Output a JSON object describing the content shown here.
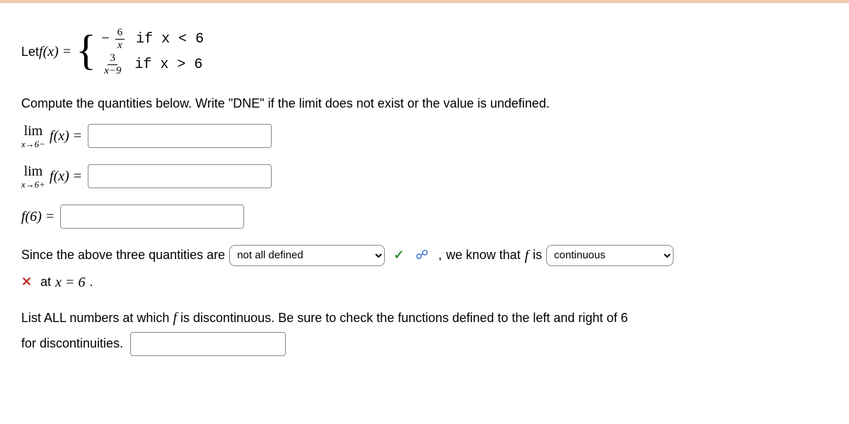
{
  "definition": {
    "leadin": "Let ",
    "fx": "f(x) = ",
    "piece1": {
      "expr_pre": "−",
      "num": "6",
      "den": "x",
      "cond": "if  x < 6"
    },
    "piece2": {
      "num": "3",
      "den": "x−9",
      "cond": "if  x > 6"
    }
  },
  "instruction": "Compute the quantities below. Write \"DNE\" if the limit does not exist or the value is undefined.",
  "lim1": {
    "top": "lim",
    "sub": "x→6−",
    "after": " f(x) ="
  },
  "lim2": {
    "top": "lim",
    "sub": "x→6+",
    "after": " f(x) ="
  },
  "lim3": {
    "label": "f(6) ="
  },
  "sentence": {
    "part1": "Since the above three quantities are",
    "dd1_value": "not all defined",
    "comma": ",",
    "part2": "we know that ",
    "f_is": "f",
    "part2b": " is",
    "dd2_value": "continuous",
    "at": "at ",
    "x_eq": "x = 6",
    "dot": "."
  },
  "discont": {
    "line1a": "List ALL numbers at which ",
    "f": "f",
    "line1b": " is discontinuous. Be sure to check the functions defined to the left and right of 6",
    "line2": "for discontinuities."
  },
  "icons": {
    "check": "✓",
    "link": "☍",
    "cross": "✕"
  }
}
